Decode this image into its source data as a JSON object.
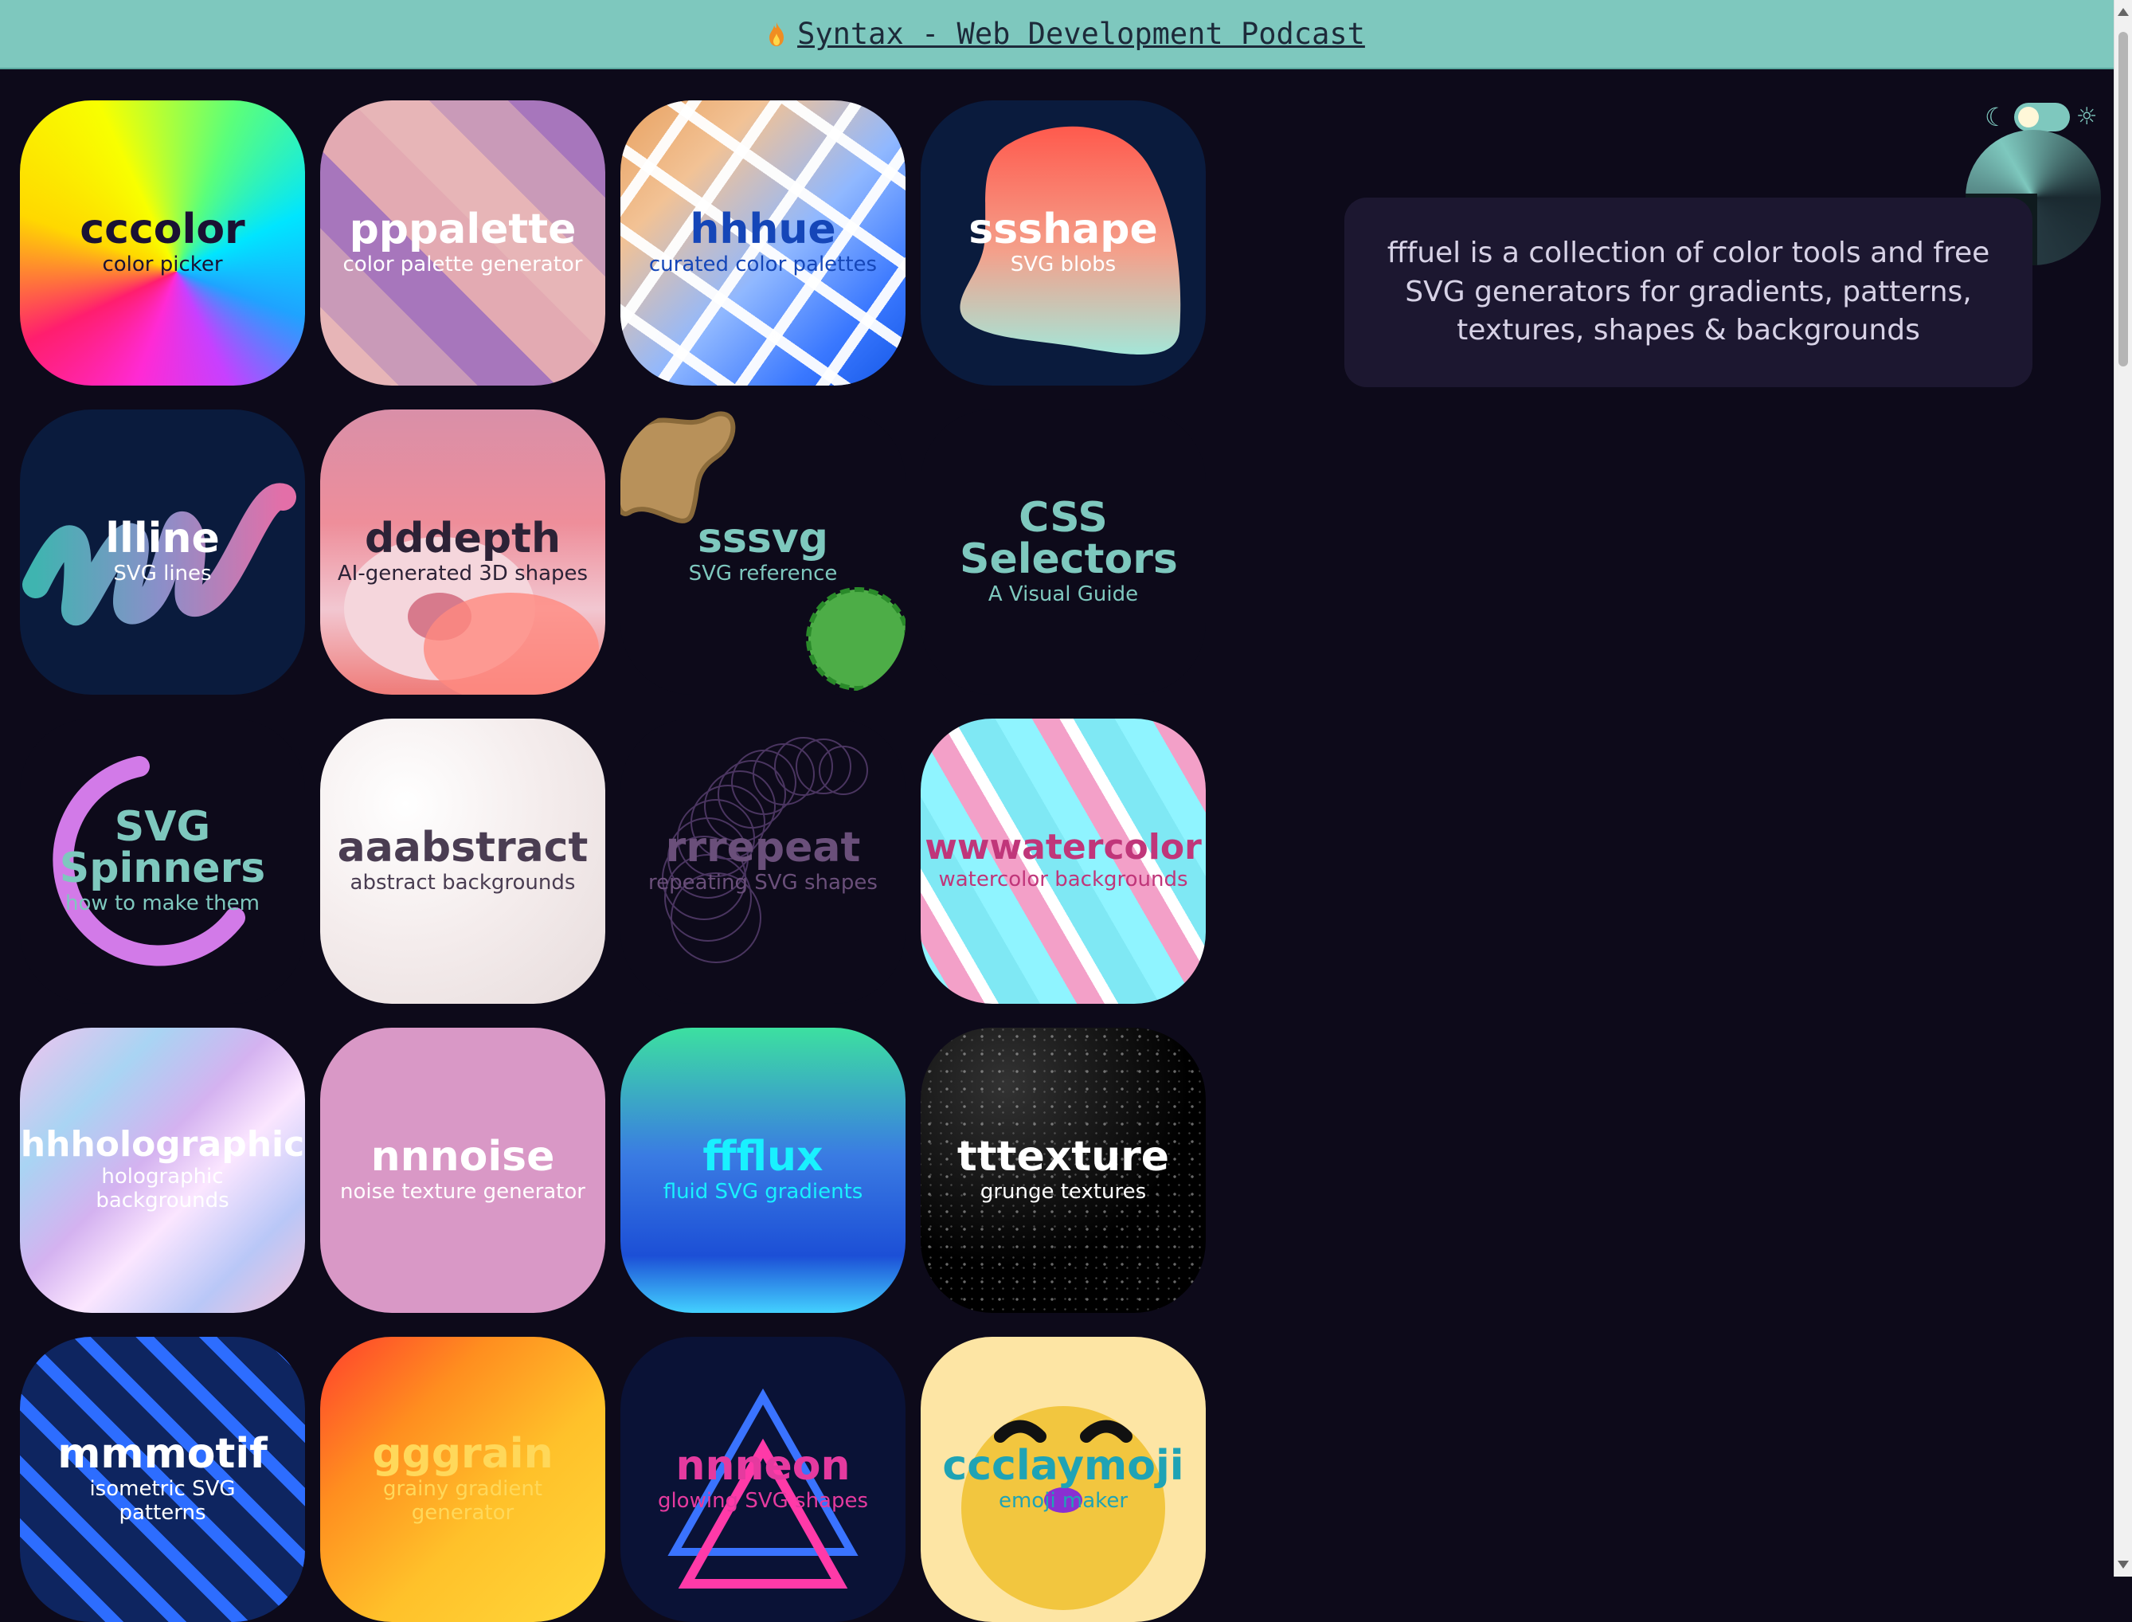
{
  "banner": {
    "text": "Syntax - Web Development Podcast"
  },
  "intro": {
    "text": "fffuel is a collection of color tools and free SVG generators for gradients, patterns, textures, shapes & backgrounds"
  },
  "tiles": [
    {
      "id": "cccolor",
      "title": "cccolor",
      "subtitle": "color picker"
    },
    {
      "id": "pppalette",
      "title": "pppalette",
      "subtitle": "color palette generator"
    },
    {
      "id": "hhhue",
      "title": "hhhue",
      "subtitle": "curated color palettes"
    },
    {
      "id": "ssshape",
      "title": "ssshape",
      "subtitle": "SVG blobs"
    },
    {
      "id": "llline",
      "title": "llline",
      "subtitle": "SVG lines"
    },
    {
      "id": "dddepth",
      "title": "dddepth",
      "subtitle": "AI-generated 3D shapes"
    },
    {
      "id": "sssvg",
      "title": "sssvg",
      "subtitle": "SVG reference"
    },
    {
      "id": "css",
      "title": "CSS Selectors",
      "subtitle": "A Visual Guide"
    },
    {
      "id": "spinners",
      "title": "SVG Spinners",
      "subtitle": "how to make them"
    },
    {
      "id": "aaabstract",
      "title": "aaabstract",
      "subtitle": "abstract backgrounds"
    },
    {
      "id": "rrrepeat",
      "title": "rrrepeat",
      "subtitle": "repeating SVG shapes"
    },
    {
      "id": "wwwatercolor",
      "title": "wwwatercolor",
      "subtitle": "watercolor backgrounds"
    },
    {
      "id": "hhholographic",
      "title": "hhholographic",
      "subtitle": "holographic backgrounds"
    },
    {
      "id": "nnnoise",
      "title": "nnnoise",
      "subtitle": "noise texture generator"
    },
    {
      "id": "ffflux",
      "title": "ffflux",
      "subtitle": "fluid SVG gradients"
    },
    {
      "id": "tttexture",
      "title": "tttexture",
      "subtitle": "grunge textures"
    },
    {
      "id": "mmmotif",
      "title": "mmmotif",
      "subtitle": "isometric SVG patterns"
    },
    {
      "id": "gggrain",
      "title": "gggrain",
      "subtitle": "grainy gradient generator"
    },
    {
      "id": "nnneon",
      "title": "nnneon",
      "subtitle": "glowing SVG shapes"
    },
    {
      "id": "ccclaymoji",
      "title": "ccclaymoji",
      "subtitle": "emoji maker"
    }
  ],
  "icons": {
    "banner": "flame-icon",
    "theme_dark": "moon-icon",
    "theme_light": "sun-icon",
    "logo": "fffuel-logo"
  },
  "theme": {
    "mode": "dark",
    "accent": "#7ec8be",
    "background": "#0d0a1a"
  }
}
